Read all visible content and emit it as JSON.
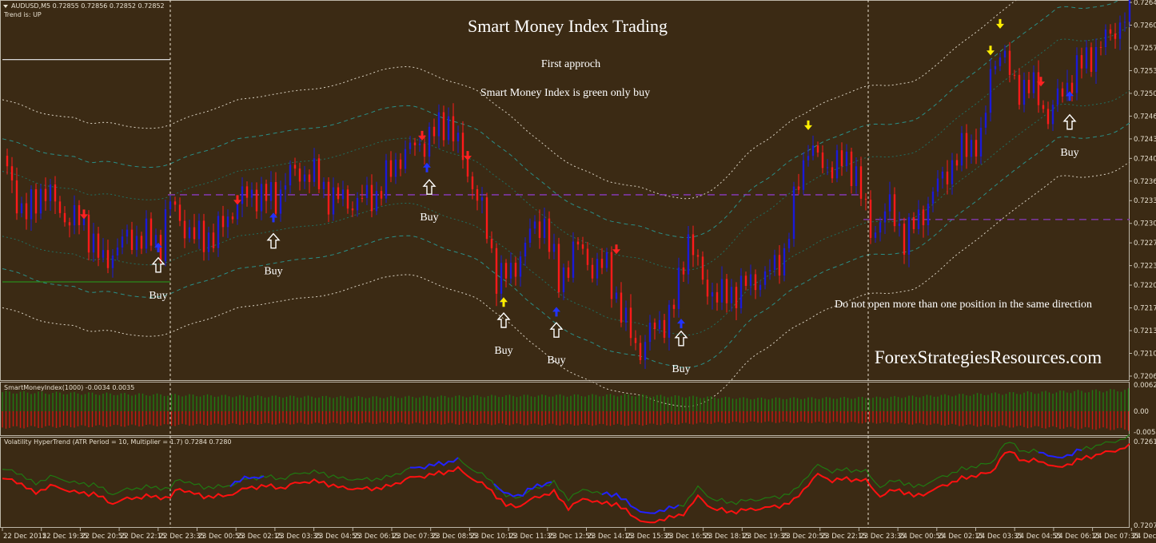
{
  "window": {
    "symbol_header": "AUDUSD,M5  0.72855 0.72856 0.72852 0.72852",
    "trend_label": "Trend is:  UP"
  },
  "annotations": {
    "title": "Smart Money Index Trading",
    "subtitle": "First approch",
    "rule": "Smart Money Index is green only buy",
    "note": "Do not open more than one position in the same direction",
    "watermark": "ForexStrategiesResources.com",
    "buy_label": "Buy"
  },
  "colors": {
    "background": "#3b2a14",
    "bull_candle": "#1a1ad8",
    "bear_candle": "#ff1a1a",
    "smi_positive": "#1f7a12",
    "smi_negative": "#c81a10",
    "hypertrend_up": "#1f7a12",
    "hypertrend_down": "#ff1010",
    "hypertrend_blue": "#2222ff",
    "level_line": "#8a3ac0",
    "arrow_blue": "#2233ff",
    "arrow_red": "#ff2222",
    "arrow_yellow": "#ffee00"
  },
  "chart_data": [
    {
      "type": "candlestick",
      "name": "AUDUSD,M5",
      "ylim": [
        0.72065,
        0.7264
      ],
      "y_ticks": [
        "0.72640",
        "0.72605",
        "0.72570",
        "0.72535",
        "0.72500",
        "0.72465",
        "0.72430",
        "0.72400",
        "0.72365",
        "0.72335",
        "0.72300",
        "0.72270",
        "0.72235",
        "0.72205",
        "0.72170",
        "0.72135",
        "0.72100",
        "0.72065"
      ],
      "x_ticks": [
        "22 Dec 2015",
        "22 Dec 19:35",
        "22 Dec 20:55",
        "22 Dec 22:15",
        "22 Dec 23:35",
        "23 Dec 00:55",
        "23 Dec 02:15",
        "23 Dec 03:35",
        "23 Dec 04:55",
        "23 Dec 06:15",
        "23 Dec 07:35",
        "23 Dec 08:55",
        "23 Dec 10:15",
        "23 Dec 11:35",
        "23 Dec 12:55",
        "23 Dec 14:15",
        "23 Dec 15:35",
        "23 Dec 16:55",
        "23 Dec 18:15",
        "23 Dec 19:35",
        "23 Dec 20:55",
        "23 Dec 22:15",
        "23 Dec 23:35",
        "24 Dec 00:55",
        "24 Dec 02:15",
        "24 Dec 03:35",
        "24 Dec 04:55",
        "24 Dec 06:15",
        "24 Dec 07:35",
        "24 Dec 08:55"
      ],
      "close_path": {
        "bar": [
          1,
          9,
          17,
          26,
          34,
          42,
          49,
          59,
          66,
          69,
          79,
          89,
          99,
          106,
          114,
          119,
          129,
          136,
          146,
          156,
          166,
          176,
          186,
          192,
          199,
          206,
          212,
          219,
          226,
          232,
          239,
          246,
          252,
          259,
          266,
          272,
          279,
          286,
          292,
          299,
          306,
          312,
          319,
          326,
          332,
          336,
          342,
          349,
          356,
          362,
          369,
          376,
          382,
          389,
          396,
          402,
          409,
          412,
          416,
          422,
          429,
          436,
          442,
          449,
          459,
          470
        ],
        "price": [
          0.72386,
          0.723,
          0.72349,
          0.72306,
          0.723,
          0.72238,
          0.72275,
          0.72287,
          0.72275,
          0.72343,
          0.72287,
          0.72287,
          0.72343,
          0.72349,
          0.72336,
          0.72373,
          0.72373,
          0.72336,
          0.72324,
          0.72336,
          0.72398,
          0.72422,
          0.72459,
          0.72398,
          0.72336,
          0.72226,
          0.72226,
          0.72287,
          0.72312,
          0.72214,
          0.72275,
          0.72238,
          0.72238,
          0.72152,
          0.72103,
          0.7214,
          0.72152,
          0.72275,
          0.72201,
          0.72177,
          0.72189,
          0.72201,
          0.72214,
          0.7225,
          0.72361,
          0.72422,
          0.72386,
          0.72398,
          0.72386,
          0.72287,
          0.72336,
          0.72287,
          0.72312,
          0.72361,
          0.72398,
          0.72422,
          0.72435,
          0.72533,
          0.7257,
          0.72508,
          0.72508,
          0.72459,
          0.72496,
          0.72533,
          0.7257,
          0.72619
        ]
      },
      "levels": [
        {
          "price": 0.72344,
          "from_bar": 69,
          "to_bar": 359,
          "style": "dashed",
          "color": "#8a3ac0"
        },
        {
          "price": 0.72306,
          "from_bar": 359,
          "to_bar": 470,
          "style": "dashed",
          "color": "#8a3ac0"
        },
        {
          "price": 0.72552,
          "from_bar": 0,
          "to_bar": 70,
          "style": "solid",
          "color": "#d8d8d8"
        },
        {
          "price": 0.7221,
          "from_bar": 0,
          "to_bar": 70,
          "style": "solid",
          "color": "#2a8a1a"
        }
      ],
      "separators_bar": [
        70,
        361
      ],
      "signals": [
        {
          "bar": 65,
          "price": 0.72263,
          "dir": "up",
          "color": "blue"
        },
        {
          "bar": 113,
          "price": 0.72309,
          "dir": "up",
          "color": "blue"
        },
        {
          "bar": 177,
          "price": 0.72386,
          "dir": "up",
          "color": "blue"
        },
        {
          "bar": 231,
          "price": 0.72164,
          "dir": "up",
          "color": "blue"
        },
        {
          "bar": 283,
          "price": 0.72146,
          "dir": "up",
          "color": "blue"
        },
        {
          "bar": 445,
          "price": 0.72496,
          "dir": "up",
          "color": "blue"
        },
        {
          "bar": 209,
          "price": 0.72179,
          "dir": "up",
          "color": "yellow"
        },
        {
          "bar": 34,
          "price": 0.72314,
          "dir": "down",
          "color": "red"
        },
        {
          "bar": 98,
          "price": 0.72336,
          "dir": "down",
          "color": "red"
        },
        {
          "bar": 175,
          "price": 0.72435,
          "dir": "down",
          "color": "red"
        },
        {
          "bar": 194,
          "price": 0.72404,
          "dir": "down",
          "color": "red"
        },
        {
          "bar": 256,
          "price": 0.7226,
          "dir": "down",
          "color": "red"
        },
        {
          "bar": 433,
          "price": 0.72518,
          "dir": "down",
          "color": "red"
        },
        {
          "bar": 336,
          "price": 0.72451,
          "dir": "down",
          "color": "yellow"
        },
        {
          "bar": 412,
          "price": 0.72566,
          "dir": "down",
          "color": "yellow"
        },
        {
          "bar": 416,
          "price": 0.72607,
          "dir": "down",
          "color": "yellow"
        }
      ],
      "buy_marks": [
        {
          "bar": 65,
          "price": 0.72236
        },
        {
          "bar": 113,
          "price": 0.72273
        },
        {
          "bar": 178,
          "price": 0.72356
        },
        {
          "bar": 209,
          "price": 0.72151
        },
        {
          "bar": 231,
          "price": 0.72136
        },
        {
          "bar": 283,
          "price": 0.72123
        },
        {
          "bar": 445,
          "price": 0.72456
        }
      ]
    },
    {
      "type": "bar",
      "name": "SmartMoneyIndex(1000) -0.0034 0.0035",
      "ylim": [
        -0.0054,
        0.0062
      ],
      "y_ticks": [
        "0.0062",
        "0.00",
        "-0.0054"
      ],
      "amplitude_profile": [
        0.0045,
        0.004,
        0.0035,
        0.0033,
        0.0036,
        0.0038,
        0.003,
        0.0032,
        0.0042,
        0.005
      ]
    },
    {
      "type": "line",
      "name": "Volatility HyperTrend (ATR Period = 10, Multiplier = 1.7) 0.7284 0.7280",
      "ylim": [
        0.7207,
        0.7261
      ],
      "y_ticks": [
        "0.7261",
        "0.7207"
      ],
      "blue_ranges": [
        [
          95,
          110
        ],
        [
          170,
          190
        ],
        [
          205,
          230
        ],
        [
          250,
          282
        ],
        [
          432,
          450
        ]
      ]
    }
  ]
}
